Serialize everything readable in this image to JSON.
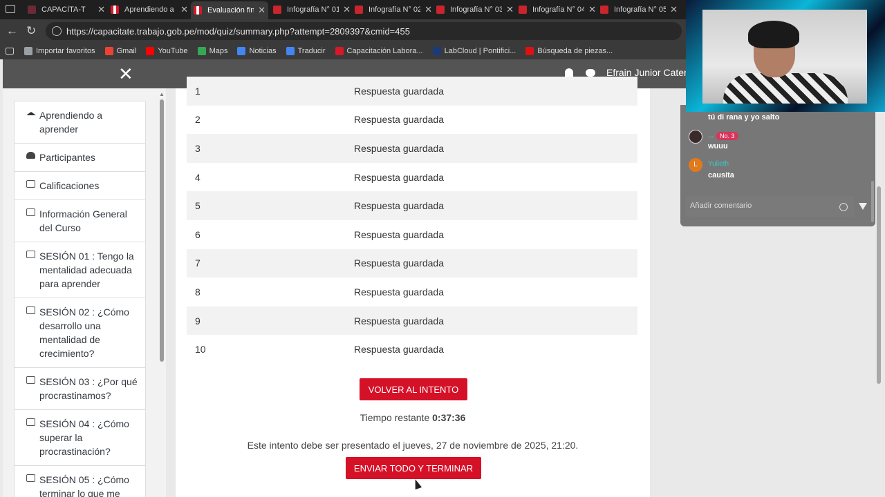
{
  "browser": {
    "tabs": [
      {
        "title": "CAPACÍTA-T",
        "icon": "gray"
      },
      {
        "title": "Aprendiendo a aprender",
        "icon": "pe"
      },
      {
        "title": "Evaluación final",
        "icon": "pe",
        "active": true
      },
      {
        "title": "Infografía N° 01",
        "icon": "pdf"
      },
      {
        "title": "Infografía N° 02",
        "icon": "pdf"
      },
      {
        "title": "Infografía N° 03",
        "icon": "pdf"
      },
      {
        "title": "Infografía N° 04",
        "icon": "pdf"
      },
      {
        "title": "Infografía N° 05",
        "icon": "pdf"
      }
    ],
    "url": "https://capacitate.trabajo.gob.pe/mod/quiz/summary.php?attempt=2809397&cmid=455",
    "bookmarks": [
      {
        "label": "Importar favoritos",
        "color": "#9aa0a6"
      },
      {
        "label": "Gmail",
        "color": "#ea4335"
      },
      {
        "label": "YouTube",
        "color": "#ff0000"
      },
      {
        "label": "Maps",
        "color": "#34a853"
      },
      {
        "label": "Noticias",
        "color": "#4285f4"
      },
      {
        "label": "Traducir",
        "color": "#4285f4"
      },
      {
        "label": "Capacitación Labora...",
        "color": "#d7182a"
      },
      {
        "label": "LabCloud | Pontifici...",
        "color": "#1a3a7a"
      },
      {
        "label": "Búsqueda de piezas...",
        "color": "#d11"
      }
    ]
  },
  "header": {
    "user_name": "Efrain Junior Cateri"
  },
  "sidebar": {
    "items": [
      {
        "label": "Aprendiendo a aprender",
        "icon": "graduation-cap-icon"
      },
      {
        "label": "Participantes",
        "icon": "users-icon"
      },
      {
        "label": "Calificaciones",
        "icon": "table-icon"
      },
      {
        "label": "Información General del Curso",
        "icon": "folder-icon"
      },
      {
        "label": "SESIÓN 01 : Tengo la mentalidad adecuada para aprender",
        "icon": "folder-icon"
      },
      {
        "label": "SESIÓN 02 : ¿Cómo desarrollo una mentalidad de crecimiento?",
        "icon": "folder-icon"
      },
      {
        "label": "SESIÓN 03 : ¿Por qué procrastinamos?",
        "icon": "folder-icon"
      },
      {
        "label": "SESIÓN 04 : ¿Cómo superar la procrastinación?",
        "icon": "folder-icon"
      },
      {
        "label": "SESIÓN 05 : ¿Cómo terminar lo que me",
        "icon": "folder-icon"
      }
    ]
  },
  "summary": {
    "rows": [
      {
        "num": "1",
        "status": "Respuesta guardada"
      },
      {
        "num": "2",
        "status": "Respuesta guardada"
      },
      {
        "num": "3",
        "status": "Respuesta guardada"
      },
      {
        "num": "4",
        "status": "Respuesta guardada"
      },
      {
        "num": "5",
        "status": "Respuesta guardada"
      },
      {
        "num": "6",
        "status": "Respuesta guardada"
      },
      {
        "num": "7",
        "status": "Respuesta guardada"
      },
      {
        "num": "8",
        "status": "Respuesta guardada"
      },
      {
        "num": "9",
        "status": "Respuesta guardada"
      },
      {
        "num": "10",
        "status": "Respuesta guardada"
      }
    ],
    "return_label": "VOLVER AL INTENTO",
    "time_label": "Tiempo restante",
    "time_value": "0:37:36",
    "due_text": "Este intento debe ser presentado el jueves, 27 de noviembre de 2025, 21:20.",
    "submit_label": "ENVIAR TODO Y TERMINAR"
  },
  "stream_chat": {
    "messages": [
      {
        "user": "",
        "text": "tú di rana y yo salto"
      },
      {
        "user": "...",
        "badge": "No. 3",
        "text": "wuuu"
      },
      {
        "user": "Yulieth",
        "avatar_letter": "L",
        "text": "causita"
      }
    ],
    "comment_placeholder": "Añadir comentario"
  },
  "colors": {
    "accent_red": "#d51128",
    "header_gray": "#545454",
    "chat_name": "#3ec8c8"
  }
}
